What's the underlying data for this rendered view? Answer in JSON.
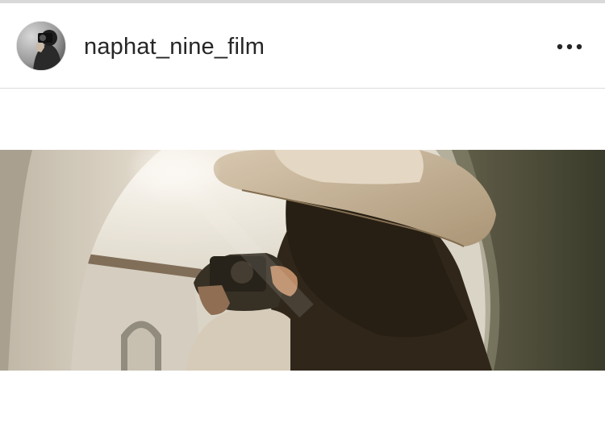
{
  "post": {
    "username": "naphat_nine_film",
    "more_icon": "more-horizontal-icon",
    "avatar_icon": "avatar-photo",
    "photo_description_icon": "post-photo"
  },
  "colors": {
    "text": "#262626",
    "divider": "#dbdbdb",
    "background": "#ffffff"
  }
}
